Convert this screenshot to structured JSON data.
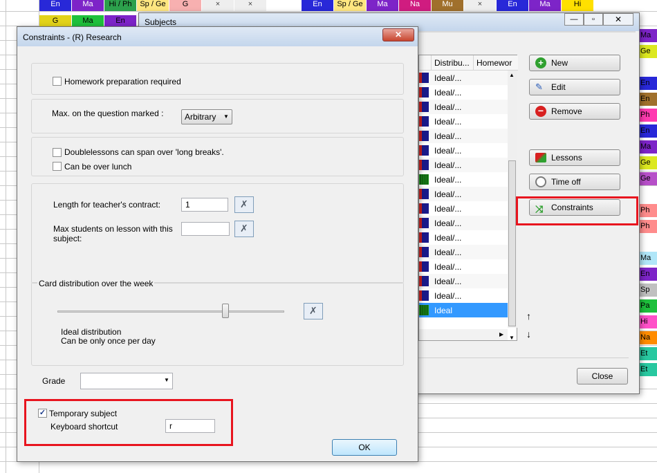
{
  "background": {
    "top_row_cells": [
      {
        "text": "En",
        "color": "#2828d8",
        "fg": "#ffffff"
      },
      {
        "text": "Ma",
        "color": "#7d24c8",
        "fg": "#ffffff"
      },
      {
        "text": "Hi / Ph",
        "color": "#2ca04c",
        "fg": "#000000"
      },
      {
        "text": "Sp / Ge",
        "color": "#ffe680",
        "fg": "#000000"
      },
      {
        "text": "G",
        "color": "#f7b0b0",
        "fg": "#000000"
      },
      {
        "text": "×",
        "color": "#eeeeee",
        "fg": "#444444"
      },
      {
        "text": "×",
        "color": "#eeeeee",
        "fg": "#444444"
      }
    ],
    "top_row2_cells": [
      {
        "text": "G",
        "color": "#e2d31a",
        "fg": "#000000"
      },
      {
        "text": "Ma",
        "color": "#1ec03c",
        "fg": "#000000"
      },
      {
        "text": "En",
        "color": "#7d24c8",
        "fg": "#000000"
      }
    ],
    "top_right_cells": [
      {
        "text": "En",
        "color": "#2828d8",
        "fg": "#ffffff"
      },
      {
        "text": "Sp / Ge",
        "color": "#ffe680",
        "fg": "#000000"
      },
      {
        "text": "Ma",
        "color": "#7d24c8",
        "fg": "#ffffff"
      },
      {
        "text": "Na",
        "color": "#d01c80",
        "fg": "#ffffff"
      },
      {
        "text": "Mu",
        "color": "#a0702c",
        "fg": "#ffffff"
      },
      {
        "text": "×",
        "color": "#eeeeee",
        "fg": "#444444"
      },
      {
        "text": "En",
        "color": "#2828d8",
        "fg": "#ffffff"
      },
      {
        "text": "Ma",
        "color": "#7d24c8",
        "fg": "#ffffff"
      },
      {
        "text": "Hi",
        "color": "#ffe000",
        "fg": "#000000"
      }
    ],
    "right_column_cells": [
      {
        "text": "Ma",
        "color": "#7d24c8"
      },
      {
        "text": "Ge",
        "color": "#dce820"
      },
      {
        "text": "",
        "color": "#ffffff"
      },
      {
        "text": "En",
        "color": "#2828d8"
      },
      {
        "text": "En",
        "color": "#a0702c"
      },
      {
        "text": "Ph",
        "color": "#ff3ab0"
      },
      {
        "text": "En",
        "color": "#2828d8"
      },
      {
        "text": "Ma",
        "color": "#7d24c8"
      },
      {
        "text": "Ge",
        "color": "#dce820"
      },
      {
        "text": "Ge",
        "color": "#b64fc8"
      },
      {
        "text": "",
        "color": "#ffffff"
      },
      {
        "text": "Ph",
        "color": "#ff8c8c"
      },
      {
        "text": "Ph",
        "color": "#ff8c8c"
      },
      {
        "text": "",
        "color": "#ffffff"
      },
      {
        "text": "Ma",
        "color": "#b0e6f8"
      },
      {
        "text": "En",
        "color": "#7d24c8"
      },
      {
        "text": "Sp",
        "color": "#c0c0c0"
      },
      {
        "text": "Pa",
        "color": "#1ec03c"
      },
      {
        "text": "Hi",
        "color": "#ff50c8"
      },
      {
        "text": "Na",
        "color": "#ff8c00"
      },
      {
        "text": "Et",
        "color": "#28c8a0"
      },
      {
        "text": "Et",
        "color": "#28c8a0"
      }
    ]
  },
  "subjects_window": {
    "title": "Subjects",
    "columns": [
      "Distribu...",
      "Homewor"
    ],
    "rows": [
      "Ideal/...",
      "Ideal/...",
      "Ideal/...",
      "Ideal/...",
      "Ideal/...",
      "Ideal/...",
      "Ideal/...",
      "Ideal/...",
      "Ideal/...",
      "Ideal/...",
      "Ideal/...",
      "Ideal/...",
      "Ideal/...",
      "Ideal/...",
      "Ideal/...",
      "Ideal/...",
      "Ideal"
    ],
    "selected_row": 16,
    "buttons": {
      "new": "New",
      "edit": "Edit",
      "remove": "Remove",
      "lessons": "Lessons",
      "time_off": "Time off",
      "constraints": "Constraints",
      "close": "Close"
    },
    "arrow_up": "↑",
    "arrow_down": "↓"
  },
  "dialog": {
    "title": "Constraints - (R) Research",
    "close_glyph": "✕",
    "homework_label": "Homework preparation required",
    "homework_checked": false,
    "max_question_label": "Max. on the question marked :",
    "max_question_value": "Arbitrary",
    "doublelessons_label": "Doublelessons can span over 'long breaks'.",
    "doublelessons_checked": false,
    "over_lunch_label": "Can be over lunch",
    "over_lunch_checked": false,
    "contract_label": "Length for teacher's contract:",
    "contract_value": "1",
    "max_students_label_line1": "Max students on lesson with this",
    "max_students_label_line2": "subject:",
    "max_students_value": "",
    "card_distribution_title": "Card distribution over the week",
    "slider_position": 0.74,
    "distribution_line1": "Ideal distribution",
    "distribution_line2": "Can be only once per day",
    "grade_label": "Grade",
    "grade_value": "",
    "temporary_label": "Temporary subject",
    "temporary_checked": true,
    "shortcut_label": "Keyboard shortcut",
    "shortcut_value": "r",
    "ok_label": "OK"
  }
}
